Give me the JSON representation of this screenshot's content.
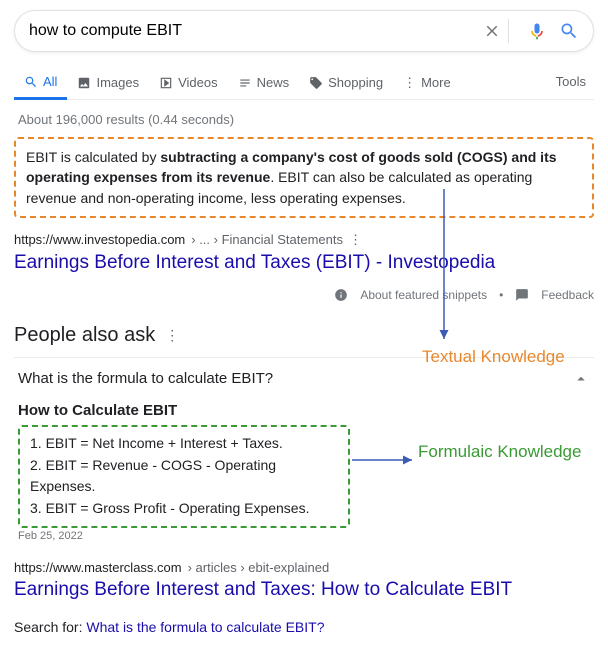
{
  "search": {
    "query": "how to compute EBIT"
  },
  "tabs": {
    "all": "All",
    "images": "Images",
    "videos": "Videos",
    "news": "News",
    "shopping": "Shopping",
    "more": "More",
    "tools": "Tools"
  },
  "stats": "About 196,000 results (0.44 seconds)",
  "featured": {
    "text_pre": "EBIT is calculated by ",
    "text_bold": "subtracting a company's cost of goods sold (COGS) and its operating expenses from its revenue",
    "text_post": ". EBIT can also be calculated as operating revenue and non-operating income, less operating expenses.",
    "url_host": "https://www.investopedia.com",
    "url_path": " › ... › Financial Statements",
    "title": "Earnings Before Interest and Taxes (EBIT) - Investopedia"
  },
  "feedback": {
    "about": "About featured snippets",
    "feedback": "Feedback"
  },
  "paa": {
    "heading": "People also ask",
    "q1": "What is the formula to calculate EBIT?",
    "a1_title": "How to Calculate EBIT",
    "a1_items": [
      "EBIT = Net Income + Interest + Taxes.",
      "EBIT = Revenue - COGS - Operating Expenses.",
      "EBIT = Gross Profit - Operating Expenses."
    ],
    "a1_date": "Feb 25, 2022"
  },
  "result2": {
    "url_host": "https://www.masterclass.com",
    "url_path": " › articles › ebit-explained",
    "title": "Earnings Before Interest and Taxes: How to Calculate EBIT"
  },
  "search_for": {
    "label": "Search for: ",
    "link": "What is the formula to calculate EBIT?"
  },
  "annotations": {
    "textual": "Textual Knowledge",
    "formulaic": "Formulaic Knowledge"
  }
}
